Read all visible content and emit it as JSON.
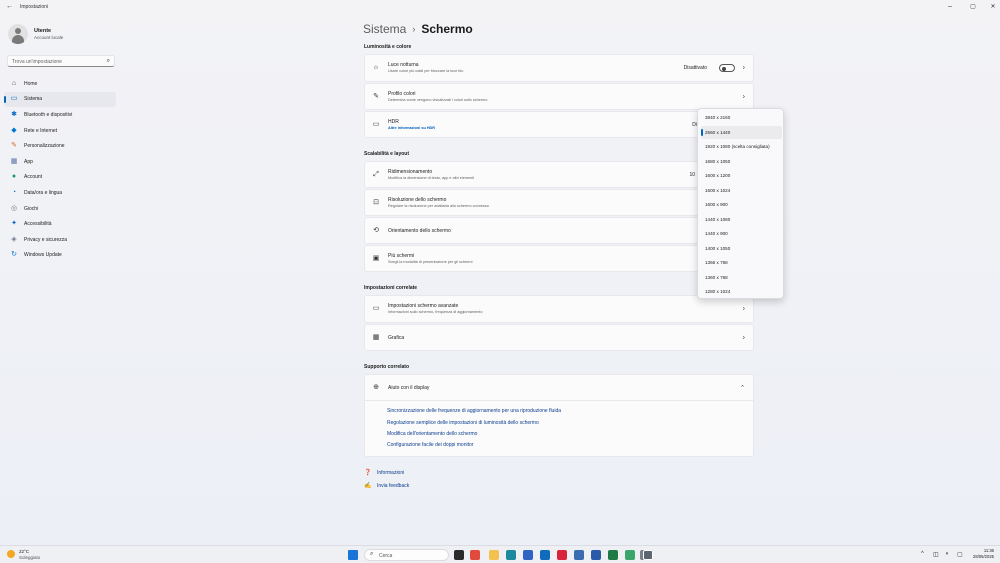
{
  "window": {
    "title": "Impostazioni",
    "back_icon": "←",
    "minimize": "–",
    "maximize": "▢",
    "close": "✕"
  },
  "profile": {
    "name": "Utente",
    "account_type": "Account locale"
  },
  "search": {
    "placeholder": "Trova un'impostazione",
    "icon": "⌕"
  },
  "nav": {
    "items": [
      {
        "label": "Home",
        "icon": "⌂",
        "color": "#444444"
      },
      {
        "label": "Sistema",
        "icon": "▭",
        "color": "#0067c0"
      },
      {
        "label": "Bluetooth e dispositivi",
        "icon": "✱",
        "color": "#0067c0"
      },
      {
        "label": "Rete e Internet",
        "icon": "◆",
        "color": "#0078d4"
      },
      {
        "label": "Personalizzazione",
        "icon": "✎",
        "color": "#d9632b"
      },
      {
        "label": "App",
        "icon": "▦",
        "color": "#5a6ea6"
      },
      {
        "label": "Account",
        "icon": "●",
        "color": "#1a9a5c"
      },
      {
        "label": "Data/ora e lingua",
        "icon": "◔",
        "color": "#0078d4"
      },
      {
        "label": "Giochi",
        "icon": "◎",
        "color": "#7a7a7a"
      },
      {
        "label": "Accessibilità",
        "icon": "✦",
        "color": "#0067c0"
      },
      {
        "label": "Privacy e sicurezza",
        "icon": "◈",
        "color": "#6f7a8c"
      },
      {
        "label": "Windows Update",
        "icon": "↻",
        "color": "#0078d4"
      }
    ],
    "active_index": 1
  },
  "breadcrumb": {
    "parent": "Sistema",
    "separator": "›",
    "current": "Schermo"
  },
  "sections": {
    "brightness": "Luminosità e colore",
    "scale": "Scalabilità e layout",
    "related": "Impostazioni correlate",
    "support": "Supporto correlato"
  },
  "cards": {
    "night_light": {
      "title": "Luce notturna",
      "subtitle": "Usare colori più caldi per bloccare la luce blu",
      "value": "Disattivato",
      "toggle_on": false,
      "icon": "☼"
    },
    "color_profile": {
      "title": "Profilo colori",
      "subtitle": "Determina come vengono visualizzati i colori sullo schermo",
      "icon": "✎"
    },
    "hdr": {
      "title": "HDR",
      "link": "Altre informazioni su HDR",
      "value": "Di",
      "icon": "▭"
    },
    "scale": {
      "title": "Ridimensionamento",
      "subtitle": "Modifica la dimensione di testo, app e altri elementi",
      "value": "10",
      "icon": "⤢"
    },
    "resolution": {
      "title": "Risoluzione dello schermo",
      "subtitle": "Regolare la risoluzione per adattarla allo schermo connesso",
      "icon": "⊡"
    },
    "orientation": {
      "title": "Orientamento dello schermo",
      "icon": "⟲"
    },
    "multi": {
      "title": "Più schermi",
      "subtitle": "Scegli la modalità di presentazione per gli schermi",
      "icon": "▣"
    },
    "advanced": {
      "title": "Impostazioni schermo avanzate",
      "subtitle": "Informazioni sullo schermo, frequenza di aggiornamento",
      "icon": "▭"
    },
    "graphics": {
      "title": "Grafica",
      "icon": "▦"
    },
    "help": {
      "title": "Aiuto con il display",
      "icon": "⊕",
      "chevron": "⌃"
    }
  },
  "help_links": [
    "Sincronizzazione delle frequenze di aggiornamento per una riproduzione fluida",
    "Regolazione semplice delle impostazioni di luminosità dello schermo",
    "Modifica dell'orientamento dello schermo",
    "Configurazione facile dei doppi monitor"
  ],
  "footer": {
    "info": {
      "label": "Informazioni",
      "icon": "❓"
    },
    "feedback": {
      "label": "Invia feedback",
      "icon": "✍"
    }
  },
  "resolution_dropdown": {
    "options": [
      "3840 x 2160",
      "2560 x 1440",
      "1920 x 1080 (scelta consigliata)",
      "1680 x 1050",
      "1600 x 1200",
      "1600 x 1024",
      "1600 x 900",
      "1440 x 1080",
      "1440 x 900",
      "1400 x 1050",
      "1366 x 768",
      "1360 x 768",
      "1280 x 1024"
    ],
    "selected_index": 1
  },
  "taskbar": {
    "weather_temp": "22°C",
    "weather_cond": "Soleggiato",
    "search_placeholder": "Cerca",
    "search_icon": "⌕",
    "time": "11:36",
    "date": "28/05/2025",
    "tray_chevron": "^",
    "tray_network": "◫",
    "tray_volume": "◖",
    "tray_extra": "▢",
    "apps": [
      {
        "name": "start",
        "color": "#1a73d9"
      },
      {
        "name": "task-view",
        "color": "#2b2b2b"
      },
      {
        "name": "chrome",
        "color": "#e04b3c"
      },
      {
        "name": "file-explorer",
        "color": "#f2c14e"
      },
      {
        "name": "edge",
        "color": "#1b8a9e"
      },
      {
        "name": "store",
        "color": "#2f63c4"
      },
      {
        "name": "outlook",
        "color": "#0f6cbd"
      },
      {
        "name": "opera",
        "color": "#d8233a"
      },
      {
        "name": "settings-tool",
        "color": "#3b6bb0"
      },
      {
        "name": "remote",
        "color": "#2a5aa8"
      },
      {
        "name": "excel",
        "color": "#1e7b45"
      },
      {
        "name": "game",
        "color": "#3aa66a"
      },
      {
        "name": "app-grey",
        "color": "#7a8088"
      },
      {
        "name": "settings",
        "color": "#5c6670"
      }
    ]
  }
}
